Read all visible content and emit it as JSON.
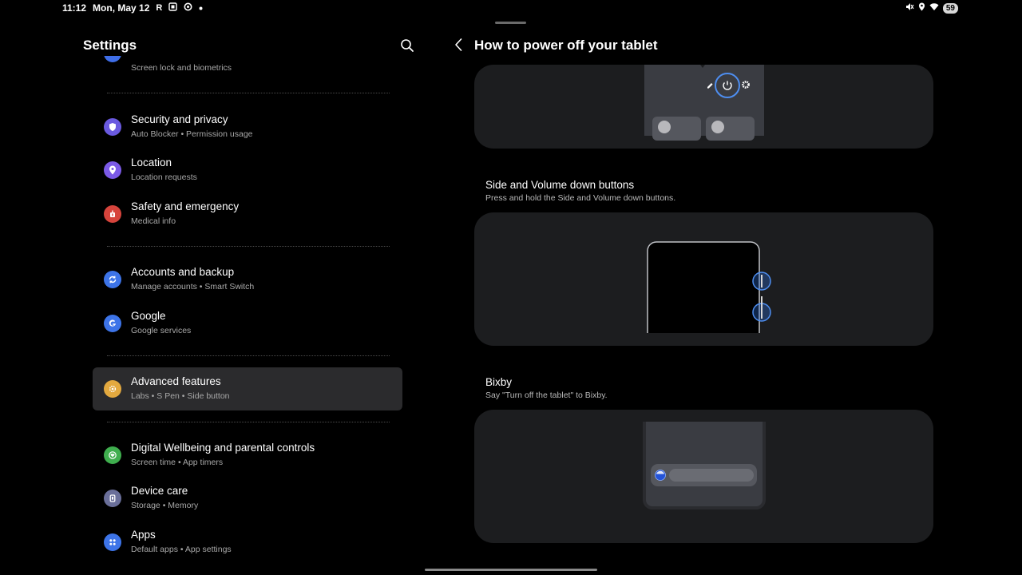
{
  "status_bar": {
    "time": "11:12",
    "date": "Mon, May 12",
    "left_icons": [
      "R",
      "screenshot-icon",
      "sync-icon",
      "dot"
    ],
    "right_icons": [
      "mute-icon",
      "location-icon",
      "wifi-icon"
    ],
    "battery": "59"
  },
  "settings": {
    "title": "Settings",
    "partial_item": {
      "subtitle": "Screen lock and biometrics"
    },
    "items": [
      {
        "title": "Security and privacy",
        "subtitle": "Auto Blocker  •  Permission usage",
        "color": "#6a5ae0"
      },
      {
        "title": "Location",
        "subtitle": "Location requests",
        "color": "#7b5ae6"
      },
      {
        "title": "Safety and emergency",
        "subtitle": "Medical info",
        "color": "#d6443c"
      },
      {
        "title": "Accounts and backup",
        "subtitle": "Manage accounts  •  Smart Switch",
        "color": "#3d74e8"
      },
      {
        "title": "Google",
        "subtitle": "Google services",
        "color": "#3d74e8"
      },
      {
        "title": "Advanced features",
        "subtitle": "Labs  •  S Pen  •  Side button",
        "color": "#e3a93f"
      },
      {
        "title": "Digital Wellbeing and parental controls",
        "subtitle": "Screen time  •  App timers",
        "color": "#3fae4e"
      },
      {
        "title": "Device care",
        "subtitle": "Storage  •  Memory",
        "color": "#6a6f9a"
      },
      {
        "title": "Apps",
        "subtitle": "Default apps  •  App settings",
        "color": "#3d74e8"
      }
    ]
  },
  "detail": {
    "title": "How to power off your tablet",
    "sections": [
      {
        "title": "Side and Volume down buttons",
        "subtitle": "Press and hold the Side and Volume down buttons."
      },
      {
        "title": "Bixby",
        "subtitle": "Say \"Turn off the tablet\" to Bixby."
      }
    ]
  }
}
